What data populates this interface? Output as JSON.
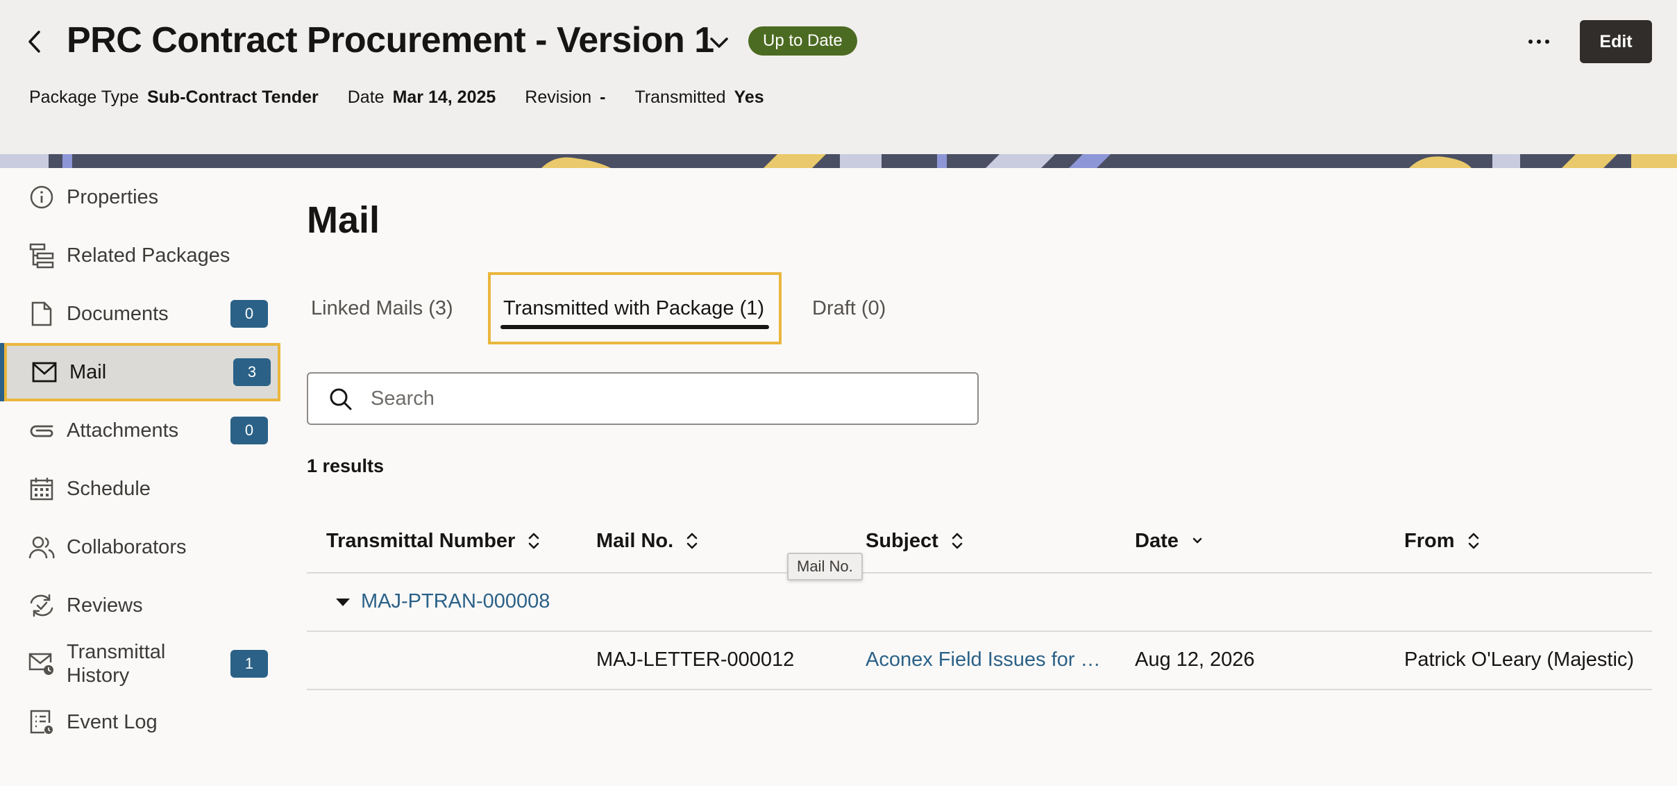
{
  "header": {
    "title": "PRC Contract Procurement - Version 1",
    "status": "Up to Date",
    "edit_label": "Edit",
    "meta": [
      {
        "label": "Package Type",
        "value": "Sub-Contract Tender"
      },
      {
        "label": "Date",
        "value": "Mar 14, 2025"
      },
      {
        "label": "Revision",
        "value": "-"
      },
      {
        "label": "Transmitted",
        "value": "Yes"
      }
    ]
  },
  "sidebar": {
    "items": [
      {
        "label": "Properties",
        "icon": "info-icon"
      },
      {
        "label": "Related Packages",
        "icon": "hierarchy-icon"
      },
      {
        "label": "Documents",
        "icon": "document-icon",
        "badge": "0"
      },
      {
        "label": "Mail",
        "icon": "mail-icon",
        "badge": "3",
        "active": true
      },
      {
        "label": "Attachments",
        "icon": "paperclip-icon",
        "badge": "0"
      },
      {
        "label": "Schedule",
        "icon": "calendar-icon"
      },
      {
        "label": "Collaborators",
        "icon": "people-icon"
      },
      {
        "label": "Reviews",
        "icon": "review-icon"
      },
      {
        "label": "Transmittal History",
        "icon": "mail-clock-icon",
        "badge": "1"
      },
      {
        "label": "Event Log",
        "icon": "log-icon"
      }
    ]
  },
  "main": {
    "title": "Mail",
    "tabs": [
      {
        "label": "Linked Mails (3)"
      },
      {
        "label": "Transmitted with Package (1)",
        "active": true
      },
      {
        "label": "Draft (0)"
      }
    ],
    "search_placeholder": "Search",
    "results_text": "1 results",
    "table": {
      "columns": [
        "Transmittal Number",
        "Mail No.",
        "Subject",
        "Date",
        "From"
      ],
      "group": "MAJ-PTRAN-000008",
      "rows": [
        {
          "mail_no": "MAJ-LETTER-000012",
          "subject": "Aconex Field Issues for …",
          "date": "Aug 12, 2026",
          "from": "Patrick O'Leary (Majestic)"
        }
      ]
    },
    "tooltip": "Mail No."
  },
  "colors": {
    "status_green": "#4c6b22",
    "badge_blue": "#2b6187",
    "highlight_gold": "#eab63e",
    "link_blue": "#2b6187"
  }
}
